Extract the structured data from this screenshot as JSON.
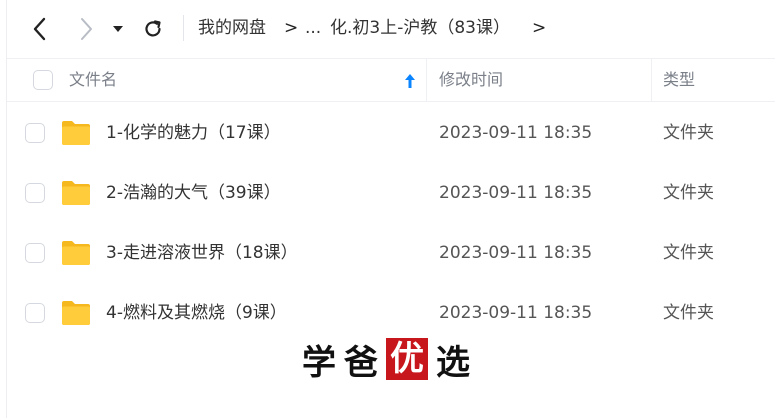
{
  "toolbar": {
    "back_icon": "chevron-left-icon",
    "forward_icon": "chevron-right-icon",
    "dropdown_icon": "caret-down-icon",
    "refresh_icon": "refresh-icon"
  },
  "breadcrumb": {
    "root": "我的网盘",
    "sep": ">",
    "ellipsis": "...",
    "current": "化.初3上-沪教（83课）",
    "trailing_sep": ">"
  },
  "table": {
    "headers": {
      "name": "文件名",
      "modified": "修改时间",
      "type": "类型"
    },
    "sort_direction": "ascending",
    "rows": [
      {
        "name": "1-化学的魅力（17课）",
        "modified": "2023-09-11 18:35",
        "type": "文件夹"
      },
      {
        "name": "2-浩瀚的大气（39课）",
        "modified": "2023-09-11 18:35",
        "type": "文件夹"
      },
      {
        "name": "3-走进溶液世界（18课）",
        "modified": "2023-09-11 18:35",
        "type": "文件夹"
      },
      {
        "name": "4-燃料及其燃烧（9课）",
        "modified": "2023-09-11 18:35",
        "type": "文件夹"
      }
    ]
  },
  "watermark": {
    "c1": "学",
    "c2": "爸",
    "c3": "优",
    "c4": "选"
  },
  "colors": {
    "folder": "#ffc933",
    "accent": "#0a84ff",
    "watermark_red": "#c8161d"
  }
}
